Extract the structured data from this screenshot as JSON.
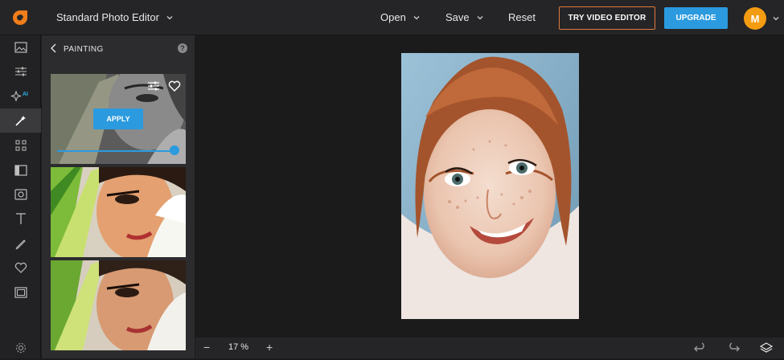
{
  "header": {
    "editor_label": "Standard Photo Editor",
    "open_label": "Open",
    "save_label": "Save",
    "reset_label": "Reset",
    "video_button_label": "TRY VIDEO EDITOR",
    "upgrade_button_label": "UPGRADE",
    "avatar_initial": "M"
  },
  "toolrail": {
    "items": [
      {
        "icon": "image-icon"
      },
      {
        "icon": "adjust-sliders-icon"
      },
      {
        "icon": "ai-sparkle-icon",
        "badge": "AI"
      },
      {
        "icon": "magic-wand-icon"
      },
      {
        "icon": "grid-icon"
      },
      {
        "icon": "frame-icon"
      },
      {
        "icon": "shape-icon"
      },
      {
        "icon": "text-icon"
      },
      {
        "icon": "brush-icon"
      },
      {
        "icon": "heart-icon"
      },
      {
        "icon": "border-icon"
      },
      {
        "icon": "settings-icon"
      }
    ]
  },
  "panel": {
    "title": "PAINTING",
    "help_glyph": "?",
    "apply_label": "APPLY",
    "strength": 1.0
  },
  "bottom": {
    "zoom_minus": "−",
    "zoom_value": "17 %",
    "zoom_plus": "+"
  },
  "colors": {
    "accent_blue": "#2b9adf",
    "accent_orange": "#e07a3c",
    "avatar": "#f39c12",
    "logo": "#f07d1b"
  }
}
